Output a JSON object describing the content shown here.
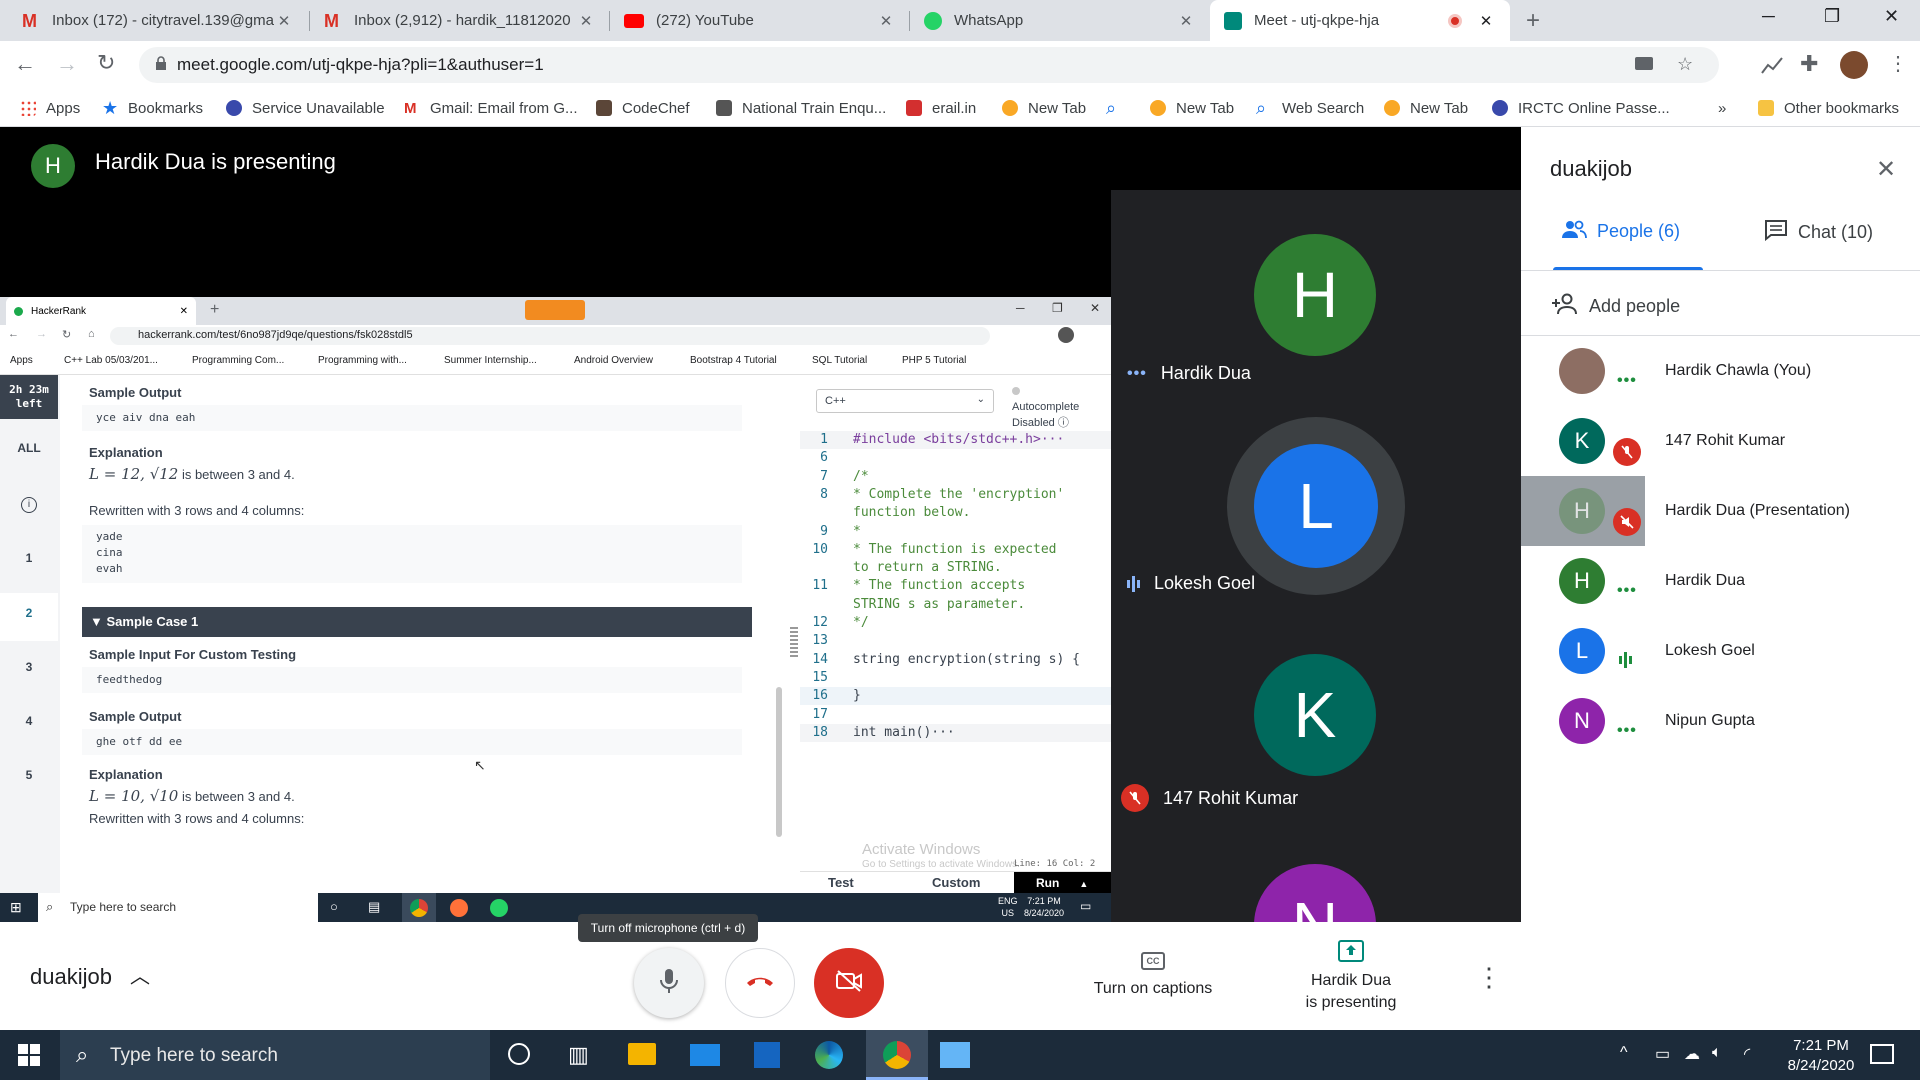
{
  "browser": {
    "tabs": [
      {
        "title": "Inbox (172) - citytravel.139@gma",
        "icon": "gmail-icon",
        "color": "#d93025"
      },
      {
        "title": "Inbox (2,912) - hardik_11812020",
        "icon": "gmail-icon",
        "color": "#d93025"
      },
      {
        "title": "(272) YouTube",
        "icon": "youtube-icon",
        "color": "#ff0000"
      },
      {
        "title": "WhatsApp",
        "icon": "whatsapp-icon",
        "color": "#25d366"
      },
      {
        "title": "Meet - utj-qkpe-hja",
        "icon": "meet-icon",
        "color": "#00897b"
      }
    ],
    "url": "meet.google.com/utj-qkpe-hja?pli=1&authuser=1",
    "bookmarks": [
      "Apps",
      "Bookmarks",
      "Service Unavailable",
      "Gmail: Email from G...",
      "CodeChef",
      "National Train Enqu...",
      "erail.in",
      "New Tab",
      "New Tab",
      "Web Search",
      "New Tab",
      "IRCTC Online Passe..."
    ],
    "bookmarks_overflow": "»",
    "other_bookmarks": "Other bookmarks"
  },
  "meet": {
    "presenter_initial": "H",
    "presenting_banner": "Hardik Dua is presenting",
    "meeting_code": "duakijob",
    "tiles": [
      {
        "initial": "H",
        "name": "Hardik Dua",
        "color": "#2e7d32",
        "status": "more"
      },
      {
        "initial": "L",
        "name": "Lokesh Goel",
        "color": "#1a73e8",
        "status": "speaking"
      },
      {
        "initial": "K",
        "name": "147 Rohit Kumar",
        "color": "#00695c",
        "status": "muted"
      },
      {
        "initial": "N",
        "name": "",
        "color": "#8e24aa",
        "status": ""
      }
    ],
    "panel": {
      "title": "duakijob",
      "tab_people": "People (6)",
      "tab_chat": "Chat (10)",
      "add_people": "Add people",
      "people": [
        {
          "name": "Hardik Chawla (You)",
          "initial": "",
          "color": "#795548",
          "status": "more"
        },
        {
          "name": "147 Rohit Kumar",
          "initial": "K",
          "color": "#00695c",
          "status": "muted"
        },
        {
          "name": "Hardik Dua (Presentation)",
          "initial": "H",
          "color": "#5f7f5f",
          "status": "presentation"
        },
        {
          "name": "Hardik Dua",
          "initial": "H",
          "color": "#2e7d32",
          "status": "more"
        },
        {
          "name": "Lokesh Goel",
          "initial": "L",
          "color": "#1a73e8",
          "status": "speaking"
        },
        {
          "name": "Nipun Gupta",
          "initial": "N",
          "color": "#8e24aa",
          "status": "more"
        }
      ]
    },
    "controls": {
      "tooltip": "Turn off microphone (ctrl + d)",
      "captions": "Turn on captions",
      "presenting_line1": "Hardik Dua",
      "presenting_line2": "is presenting"
    }
  },
  "shared": {
    "tab_title": "HackerRank",
    "url": "hackerrank.com/test/6no987jd9qe/questions/fsk028stdl5",
    "bookmarks": [
      "Apps",
      "C++ Lab 05/03/201...",
      "Programming Com...",
      "Programming with...",
      "Summer Internship...",
      "Android Overview",
      "Bootstrap 4 Tutorial",
      "SQL Tutorial",
      "PHP 5 Tutorial"
    ],
    "timer": "2h 23m left",
    "nav": [
      "ALL",
      "i",
      "1",
      "2",
      "3",
      "4",
      "5"
    ],
    "problem": {
      "sample_output_heading": "Sample Output",
      "sample_output_0": "yce aiv dna eah",
      "explanation_heading": "Explanation",
      "expl_0_formula": "L = 12, √12",
      "expl_0_text": " is between 3 and 4.",
      "rewritten_0": "Rewritten with 3 rows and 4 columns:",
      "grid_0": [
        "yade",
        "cina",
        "evah"
      ],
      "sample_case_1": "▼ Sample Case 1",
      "custom_input_heading": "Sample Input For Custom Testing",
      "custom_input_1": "feedthedog",
      "sample_output_heading_1": "Sample Output",
      "sample_output_1": "ghe otf dd ee",
      "explanation_heading_1": "Explanation",
      "expl_1_formula": "L = 10, √10",
      "expl_1_text": " is between 3 and 4.",
      "rewritten_1": "Rewritten with 3 rows and 4 columns:"
    },
    "editor": {
      "language": "C++",
      "autocomplete": "Autocomplete",
      "autocomplete_state": "Disabled",
      "lines": [
        {
          "n": "1",
          "t": "#include <bits/stdc++.h>···"
        },
        {
          "n": "6",
          "t": ""
        },
        {
          "n": "7",
          "t": "/*"
        },
        {
          "n": "8",
          "t": " * Complete the 'encryption'"
        },
        {
          "n": "",
          "t": "function below."
        },
        {
          "n": "9",
          "t": " *"
        },
        {
          "n": "10",
          "t": " * The function is expected"
        },
        {
          "n": "",
          "t": "to return a STRING."
        },
        {
          "n": "11",
          "t": " * The function accepts"
        },
        {
          "n": "",
          "t": "STRING s as parameter."
        },
        {
          "n": "12",
          "t": " */"
        },
        {
          "n": "13",
          "t": ""
        },
        {
          "n": "14",
          "t": "string encryption(string s) {"
        },
        {
          "n": "15",
          "t": ""
        },
        {
          "n": "16",
          "t": "}"
        },
        {
          "n": "17",
          "t": ""
        },
        {
          "n": "18",
          "t": "int main()···"
        }
      ],
      "watermark_1": "Activate Windows",
      "watermark_2": "Go to Settings to activate Windows.",
      "status": "Line: 16 Col: 2",
      "tab_test": "Test",
      "tab_custom": "Custom",
      "run": "Run"
    },
    "taskbar": {
      "search": "Type here to search",
      "lang": "ENG",
      "region": "US",
      "time": "7:21 PM",
      "date": "8/24/2020"
    }
  },
  "taskbar": {
    "search": "Type here to search",
    "time": "7:21 PM",
    "date": "8/24/2020"
  }
}
